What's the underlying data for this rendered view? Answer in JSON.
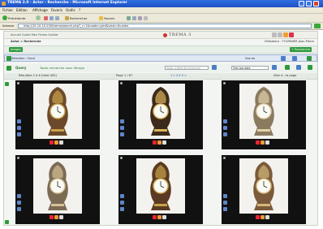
{
  "window": {
    "title": "TREMA 3.0 - Actor - Recherche - Microsoft Internet Explorer",
    "controls": [
      "minimize-button",
      "maximize-button",
      "close-button"
    ]
  },
  "menu": [
    "Fichier",
    "Edition",
    "Affichage",
    "Favoris",
    "Outils",
    "?"
  ],
  "toolbar": {
    "back": "Précédente",
    "search": "Rechercher",
    "favorites": "Favoris"
  },
  "address": {
    "label": "Adresse",
    "url": "http://10.10.10.200/trema/search.php?_r=1&mode=grid&view=thumbs"
  },
  "app": {
    "top_links": "Accueil  Guide  Mes Fiches  Quitter",
    "logo": "TREMA 3",
    "breadcrumb": "Actor > Recherche",
    "utility": "Utilisateur : TOURNIER Jean-Pierre",
    "left_green_button": "Images",
    "right_green_button": "+ Recherche",
    "selection_label": "Sélection : Fond",
    "selection_label_2": "Fond",
    "view_label": "Vue en",
    "query_label": "Query",
    "query_text": "Toute recherche sans filtrage",
    "search_placeholder": "Saisir critère de recherche",
    "sort_select": "Trier par date",
    "results_info": "Résultats 1 à 6 (total 400)",
    "page_info": "Page 1 / 67",
    "page_numbers": "1 2 3 4 5 >",
    "per_page": "Aller à : la page"
  },
  "cards": [
    {
      "id": 1,
      "caption": "Clock 1",
      "tone": "#6b4a2b",
      "accent": "#c9a24a"
    },
    {
      "id": 2,
      "caption": "Clock 2",
      "tone": "#3c2a1a",
      "accent": "#d8b45a"
    },
    {
      "id": 3,
      "caption": "Clock 3",
      "tone": "#8a7a60",
      "accent": "#e2d2a8"
    },
    {
      "id": 4,
      "caption": "Clock 4",
      "tone": "#7b6b55",
      "accent": "#d6c196"
    },
    {
      "id": 5,
      "caption": "Clock 5",
      "tone": "#5a3a22",
      "accent": "#c9a24a"
    },
    {
      "id": 6,
      "caption": "Clock 6",
      "tone": "#7a5a3a",
      "accent": "#d3b87a"
    }
  ]
}
